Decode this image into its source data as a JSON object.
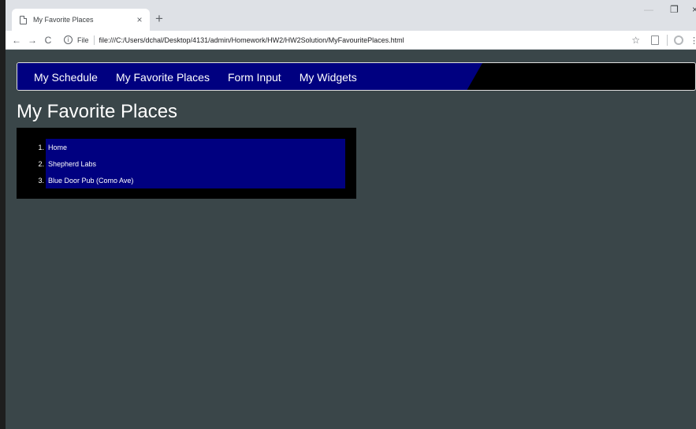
{
  "browser": {
    "tab_title": "My Favorite Places",
    "tab_close": "×",
    "new_tab": "+",
    "window_min": "—",
    "window_max": "❐",
    "window_close": "×",
    "nav_back": "←",
    "nav_forward": "→",
    "nav_reload": "C",
    "info_icon": "i",
    "url_scheme": "File",
    "url": "file:///C:/Users/dchal/Desktop/4131/admin/Homework/HW2/HW2Solution/MyFavouritePlaces.html",
    "star_icon": "☆",
    "menu_icon": "⋮"
  },
  "nav": {
    "links": [
      "My Schedule",
      "My Favorite Places",
      "Form Input",
      "My Widgets"
    ]
  },
  "page": {
    "title": "My Favorite Places"
  },
  "places": [
    {
      "num": "1.",
      "name": "Home"
    },
    {
      "num": "2.",
      "name": "Shepherd Labs"
    },
    {
      "num": "3.",
      "name": "Blue Door Pub (Como Ave)"
    }
  ],
  "colors": {
    "page_bg": "#3a4649",
    "nav_accent": "#000080",
    "nav_bg": "#000000"
  }
}
